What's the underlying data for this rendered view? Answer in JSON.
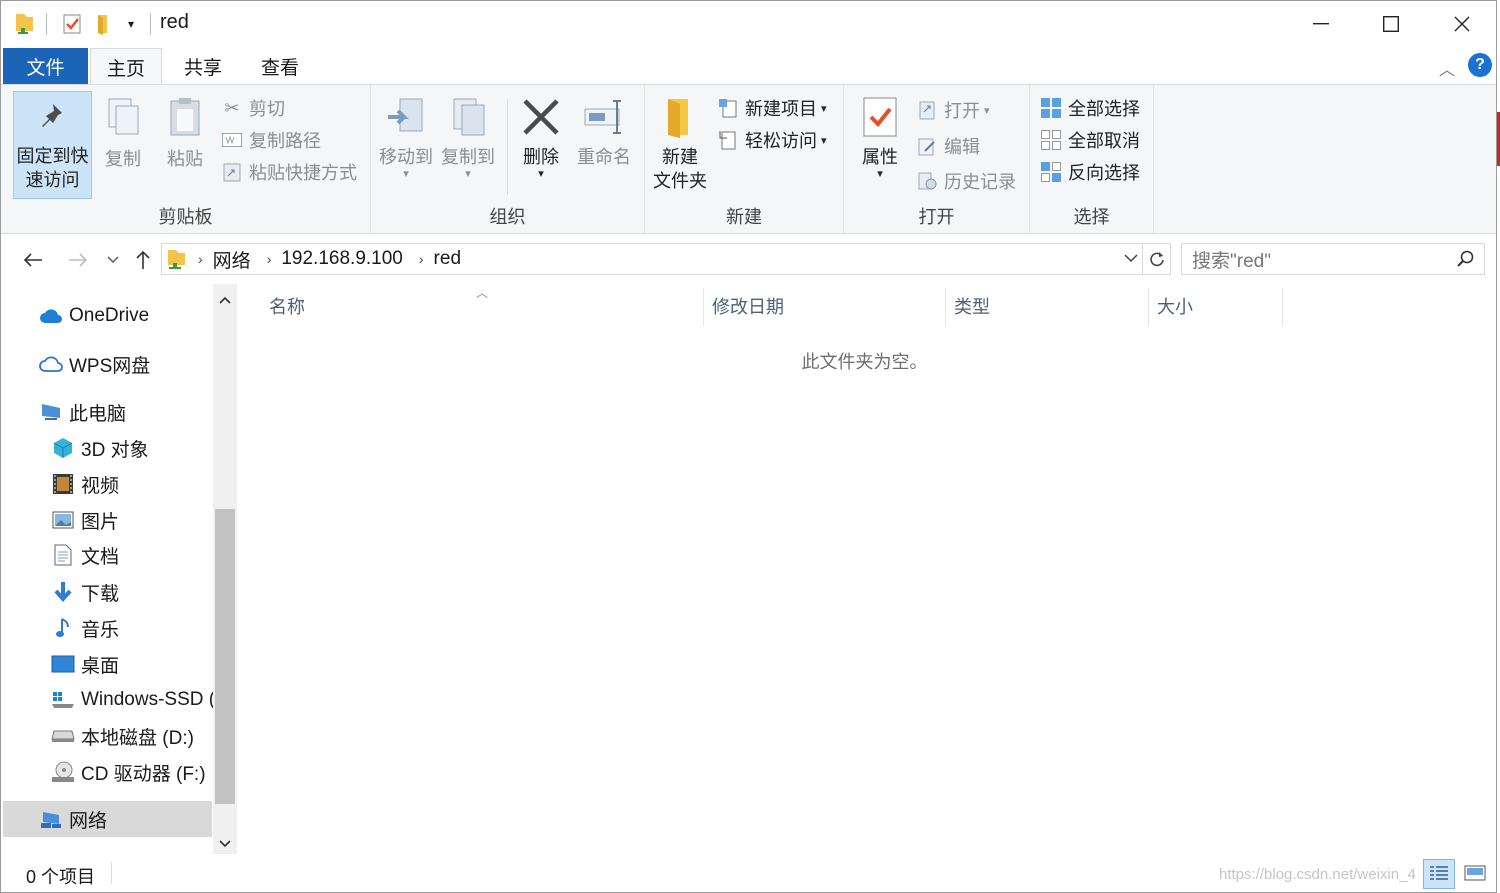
{
  "window": {
    "title": "red",
    "minimize": "—",
    "maximize": "☐",
    "close": "✕"
  },
  "tabs": {
    "file": "文件",
    "home": "主页",
    "share": "共享",
    "view": "查看",
    "help": "?"
  },
  "ribbon": {
    "clipboard": {
      "label": "剪贴板",
      "pin_line1": "固定到快",
      "pin_line2": "速访问",
      "copy": "复制",
      "paste": "粘贴",
      "cut": "剪切",
      "copy_path": "复制路径",
      "paste_shortcut": "粘贴快捷方式"
    },
    "organize": {
      "label": "组织",
      "move_to": "移动到",
      "copy_to": "复制到",
      "delete": "删除",
      "rename": "重命名"
    },
    "new": {
      "label": "新建",
      "new_folder_line1": "新建",
      "new_folder_line2": "文件夹",
      "new_item": "新建项目",
      "easy_access": "轻松访问"
    },
    "open": {
      "label": "打开",
      "properties": "属性",
      "open": "打开",
      "edit": "编辑",
      "history": "历史记录"
    },
    "select": {
      "label": "选择",
      "select_all": "全部选择",
      "select_none": "全部取消",
      "invert": "反向选择"
    }
  },
  "address": {
    "crumbs": [
      "网络",
      "192.168.9.100",
      "red"
    ],
    "search_placeholder": "搜索\"red\""
  },
  "nav_pane": {
    "items": [
      {
        "label": "OneDrive",
        "icon": "onedrive-cloud-icon"
      },
      {
        "label": "WPS网盘",
        "icon": "wps-cloud-icon"
      },
      {
        "label": "此电脑",
        "icon": "this-pc-icon"
      },
      {
        "label": "3D 对象",
        "icon": "3d-objects-icon"
      },
      {
        "label": "视频",
        "icon": "video-icon"
      },
      {
        "label": "图片",
        "icon": "pictures-icon"
      },
      {
        "label": "文档",
        "icon": "documents-icon"
      },
      {
        "label": "下载",
        "icon": "download-icon"
      },
      {
        "label": "音乐",
        "icon": "music-icon"
      },
      {
        "label": "桌面",
        "icon": "desktop-icon"
      },
      {
        "label": "Windows-SSD (",
        "icon": "ssd-drive-icon"
      },
      {
        "label": "本地磁盘 (D:)",
        "icon": "hard-drive-icon"
      },
      {
        "label": "CD 驱动器 (F:)",
        "icon": "cd-drive-icon"
      },
      {
        "label": "网络",
        "icon": "network-icon"
      }
    ]
  },
  "content": {
    "columns": [
      "名称",
      "修改日期",
      "类型",
      "大小"
    ],
    "empty_message": "此文件夹为空。"
  },
  "status": {
    "count": "0 个项目",
    "watermark": "https://blog.csdn.net/weixin_4"
  },
  "colors": {
    "accent": "#1b64b8",
    "ribbon_bg": "#f5f6f7",
    "selected_nav": "#d9d9d9"
  }
}
